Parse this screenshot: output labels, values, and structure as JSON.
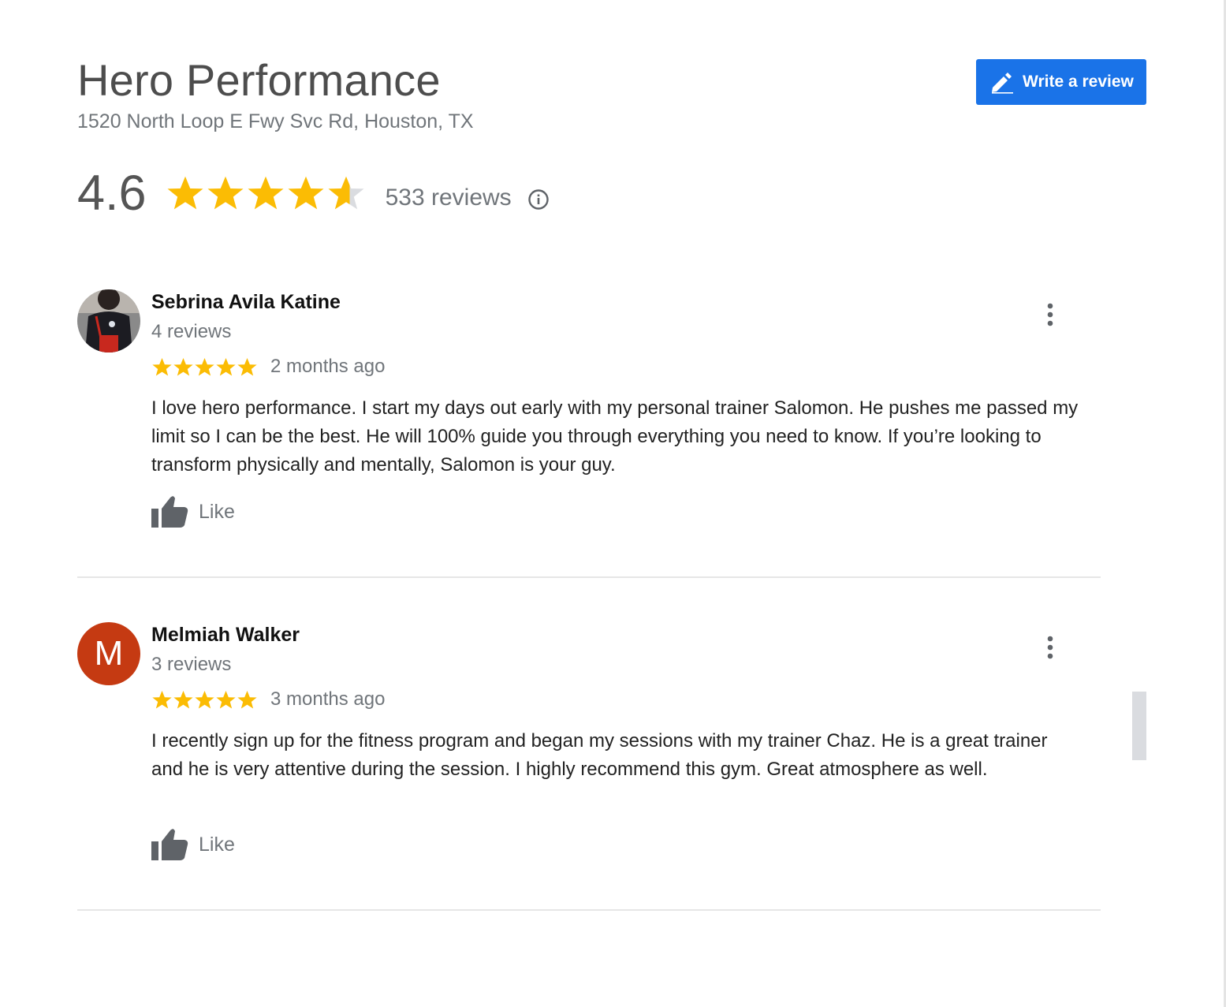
{
  "place": {
    "name": "Hero Performance",
    "address": "1520 North Loop E Fwy Svc Rd, Houston, TX"
  },
  "write_review": {
    "label": "Write a review",
    "icon": "pencil-icon",
    "color": "#1a73e8"
  },
  "summary": {
    "rating": "4.6",
    "rating_value": 4.6,
    "stars_max": 5,
    "review_count": "533 reviews",
    "info_icon": "info-icon",
    "star_color": "#fbbc04"
  },
  "reviews": [
    {
      "author": "Sebrina Avila Katine",
      "author_reviews": "4 reviews",
      "avatar_type": "photo",
      "stars": 5,
      "date": "2 months ago",
      "text": "I love hero performance. I start my days out early with my personal trainer Salomon. He pushes me passed my limit so I can be the best. He will 100% guide you through everything you need to know. If you’re looking to transform physically and mentally, Salomon is your guy.",
      "like_label": "Like"
    },
    {
      "author": "Melmiah Walker",
      "author_reviews": "3 reviews",
      "avatar_type": "letter",
      "avatar_letter": "M",
      "avatar_color": "#c53a12",
      "stars": 5,
      "date": "3 months ago",
      "text": "I recently sign up for the fitness program and began my sessions with my trainer Chaz. He is a great trainer and he is very attentive during the session. I highly recommend this gym. Great atmosphere as well.",
      "like_label": "Like"
    }
  ]
}
